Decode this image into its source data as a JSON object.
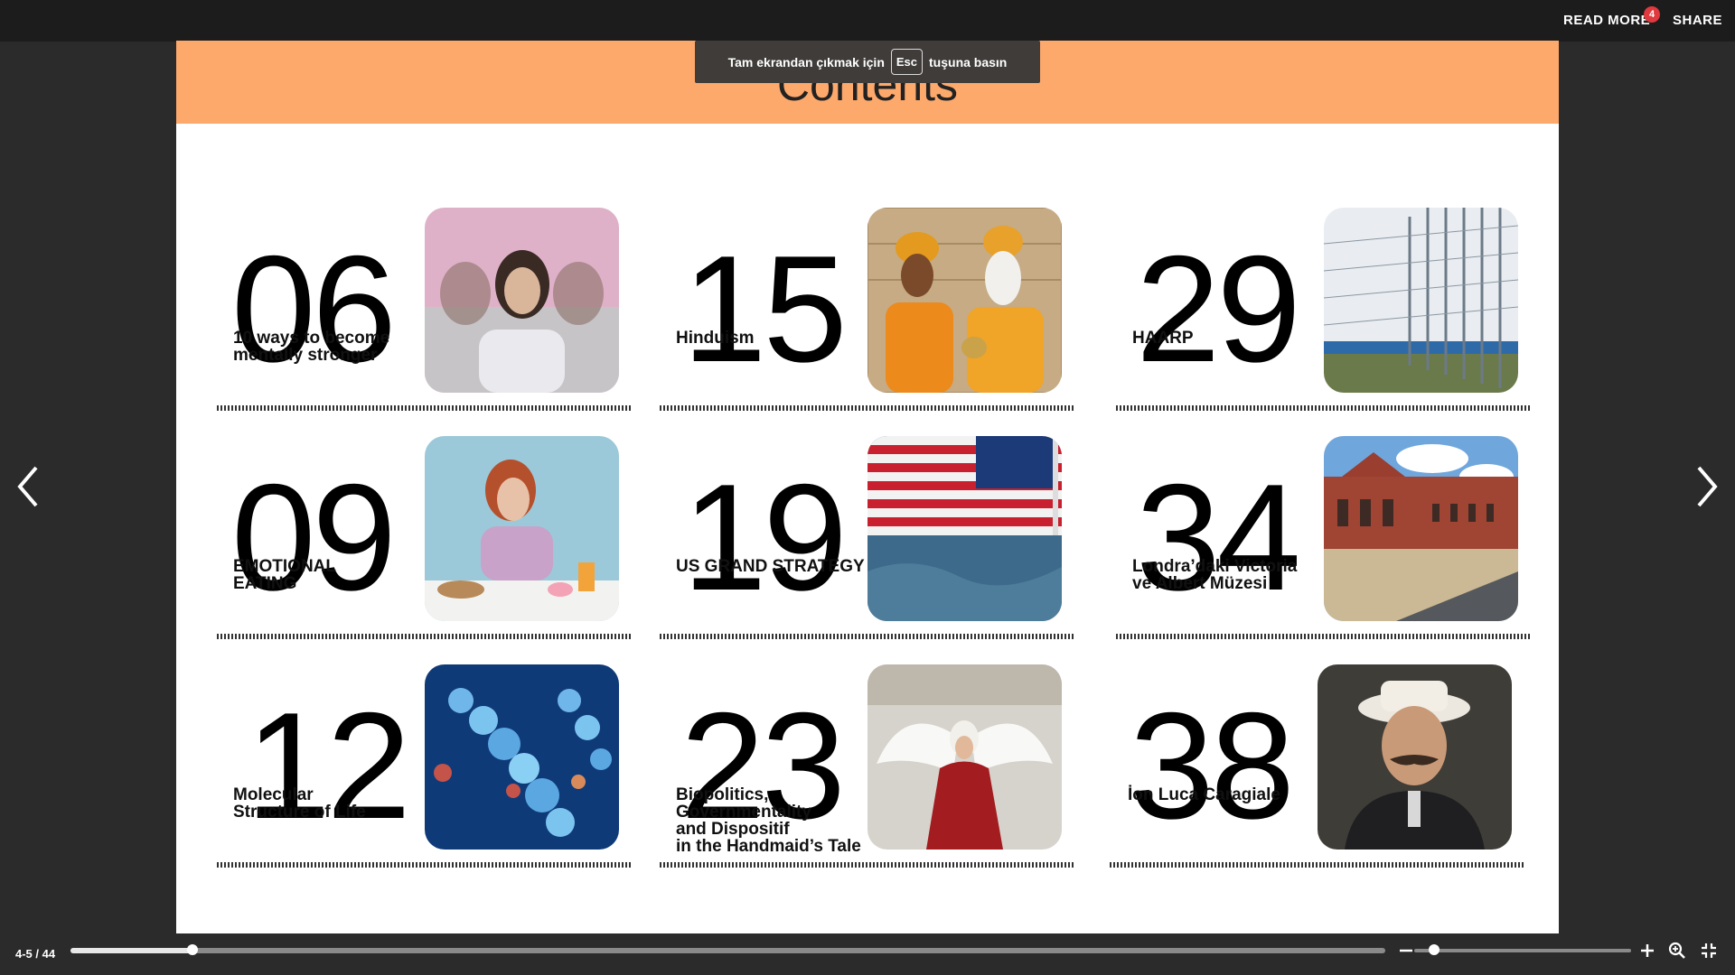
{
  "topbar": {
    "read_more_label": "READ MORE",
    "read_more_badge": "4",
    "share_label": "SHARE"
  },
  "toast": {
    "before": "Tam ekrandan çıkmak için",
    "key": "Esc",
    "after": "tuşuna basın"
  },
  "page": {
    "title": "Contents",
    "header_color": "#fea96c",
    "items": [
      {
        "number": "06",
        "label": "10 ways  to become\nmentally stronger",
        "image": "woman-stressed-photo"
      },
      {
        "number": "15",
        "label": "Hinduism",
        "image": "sadhus-photo"
      },
      {
        "number": "29",
        "label": "HAARP",
        "image": "antenna-array-photo"
      },
      {
        "number": "09",
        "label": "EMOTIONAL\nEATING",
        "image": "woman-eating-photo"
      },
      {
        "number": "19",
        "label": "US GRAND STRATEGY",
        "image": "us-flag-photo"
      },
      {
        "number": "34",
        "label": "Londra’daki Victoria\nve Albert Müzesi",
        "image": "museum-photo"
      },
      {
        "number": "12",
        "label": "Molecular\nStructure of Life",
        "image": "molecules-photo"
      },
      {
        "number": "23",
        "label": "Biopolitics,\nGovernmentality\nand Dispositif\nin the Handmaid’s Tale",
        "image": "handmaid-angel-photo"
      },
      {
        "number": "38",
        "label": "İon Luca Caragiale",
        "image": "portrait-man-photo"
      }
    ]
  },
  "navigation": {
    "page_indicator": "4-5 / 44",
    "current_page": 5,
    "total_pages": 44,
    "zoom_level_fraction": 0.09
  },
  "icons": {
    "prev": "chevron-left-icon",
    "next": "chevron-right-icon",
    "zoom_out": "minus-icon",
    "zoom_in": "plus-icon",
    "zoom_search": "magnifier-zoom-icon",
    "fullscreen_exit": "exit-fullscreen-icon"
  },
  "colors": {
    "accent_header": "#fea96c",
    "badge": "#e0393e",
    "toast_bg": "#3f3c3a"
  }
}
